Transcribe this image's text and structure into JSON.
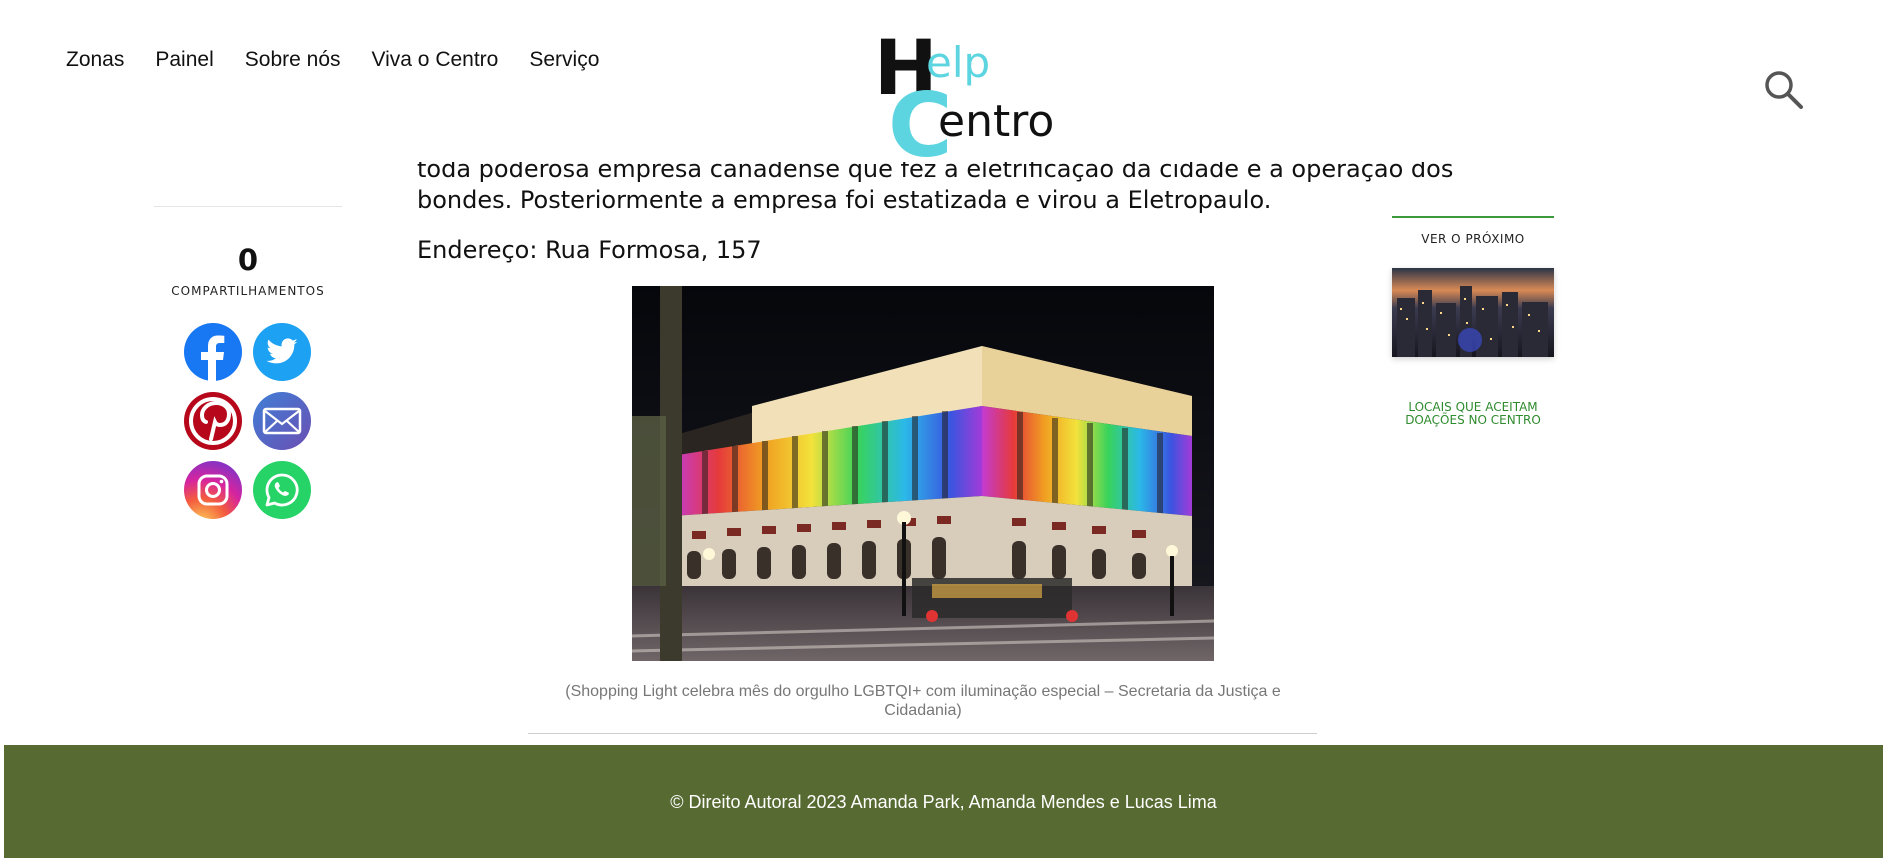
{
  "nav": {
    "items": [
      "Zonas",
      "Painel",
      "Sobre nós",
      "Viva o Centro",
      "Serviço"
    ]
  },
  "logo": {
    "part1": "H",
    "part2": "elp",
    "part3": "C",
    "part4": "entro"
  },
  "share": {
    "count": "0",
    "label": "COMPARTILHAMENTOS",
    "networks": [
      "facebook",
      "twitter",
      "pinterest",
      "email",
      "instagram",
      "whatsapp"
    ]
  },
  "article": {
    "cut_line": "toda poderosa empresa canadense que fez a eletrificação da cidade e a operação dos",
    "paragraph_end": "bondes. Posteriormente a empresa foi estatizada e virou a Eletropaulo.",
    "address": "Endereço: Rua Formosa, 157",
    "caption": "(Shopping Light celebra mês do orgulho LGBTQI+ com iluminação especial – Secretaria da Justiça e Cidadania)"
  },
  "sidebar": {
    "next_label": "VER O PRÓXIMO",
    "next_title": "LOCAIS QUE ACEITAM DOAÇÕES NO CENTRO"
  },
  "footer": {
    "text": "© Direito Autoral 2023 Amanda Park, Amanda Mendes e Lucas Lima"
  },
  "colors": {
    "footer_bg": "#566a31",
    "accent_green": "#3c9a3c",
    "logo_cyan": "#5dd5e0"
  }
}
